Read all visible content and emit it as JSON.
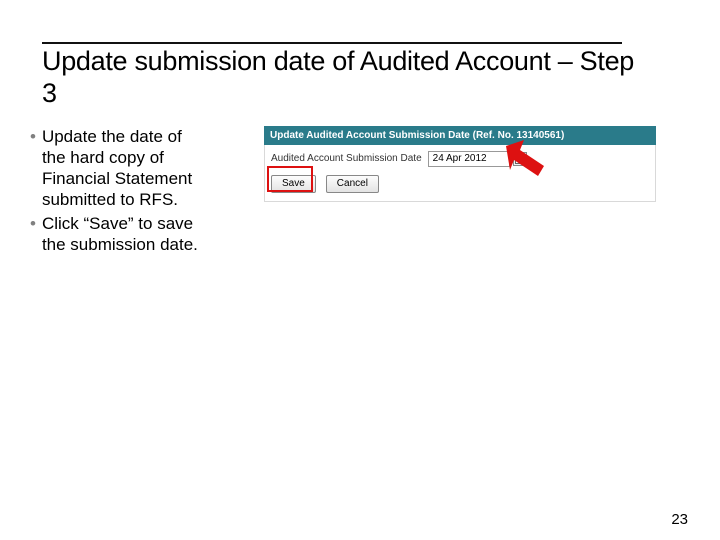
{
  "slide": {
    "title": "Update submission date of Audited Account – Step 3",
    "bullets": [
      "Update the date of the hard copy of Financial Statement submitted to RFS.",
      "Click “Save” to save the submission date."
    ],
    "page_number": "23"
  },
  "panel": {
    "header": "Update Audited Account Submission Date (Ref. No. 13140561)",
    "field_label": "Audited Account Submission Date",
    "date_value": "24 Apr 2012",
    "save_label": "Save",
    "cancel_label": "Cancel"
  }
}
